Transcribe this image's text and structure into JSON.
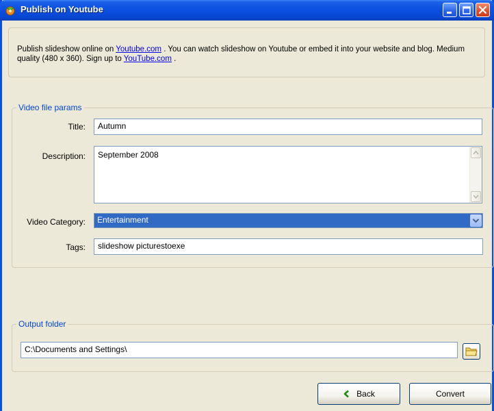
{
  "window": {
    "title": "Publish on Youtube",
    "titlebar_color": "#0a4fe0",
    "app_icon": "slideshow-app-icon"
  },
  "info": {
    "text_before_link1": "Publish slideshow online on ",
    "link1": "Youtube.com",
    "text_after_link1": " . You can watch slideshow on Youtube or embed it into your website and blog. Medium quality (480 x 360). Sign up to ",
    "link2": "YouTube.com",
    "text_after_link2": " ."
  },
  "params": {
    "legend": "Video file params",
    "title_label": "Title:",
    "title_value": "Autumn",
    "description_label": "Description:",
    "description_value": "September 2008",
    "category_label": "Video Category:",
    "category_value": "Entertainment",
    "tags_label": "Tags:",
    "tags_value": "slideshow picturestoexe"
  },
  "output": {
    "legend": "Output folder",
    "folder_value": "C:\\Documents and Settings\\",
    "browse_icon": "folder-icon"
  },
  "buttons": {
    "back_label": "Back",
    "back_icon": "chevron-left-icon",
    "convert_label": "Convert"
  },
  "colors": {
    "link": "#0000ee",
    "legend": "#0046d5",
    "selection": "#316ac5",
    "dialog_bg": "#ece9d8"
  }
}
